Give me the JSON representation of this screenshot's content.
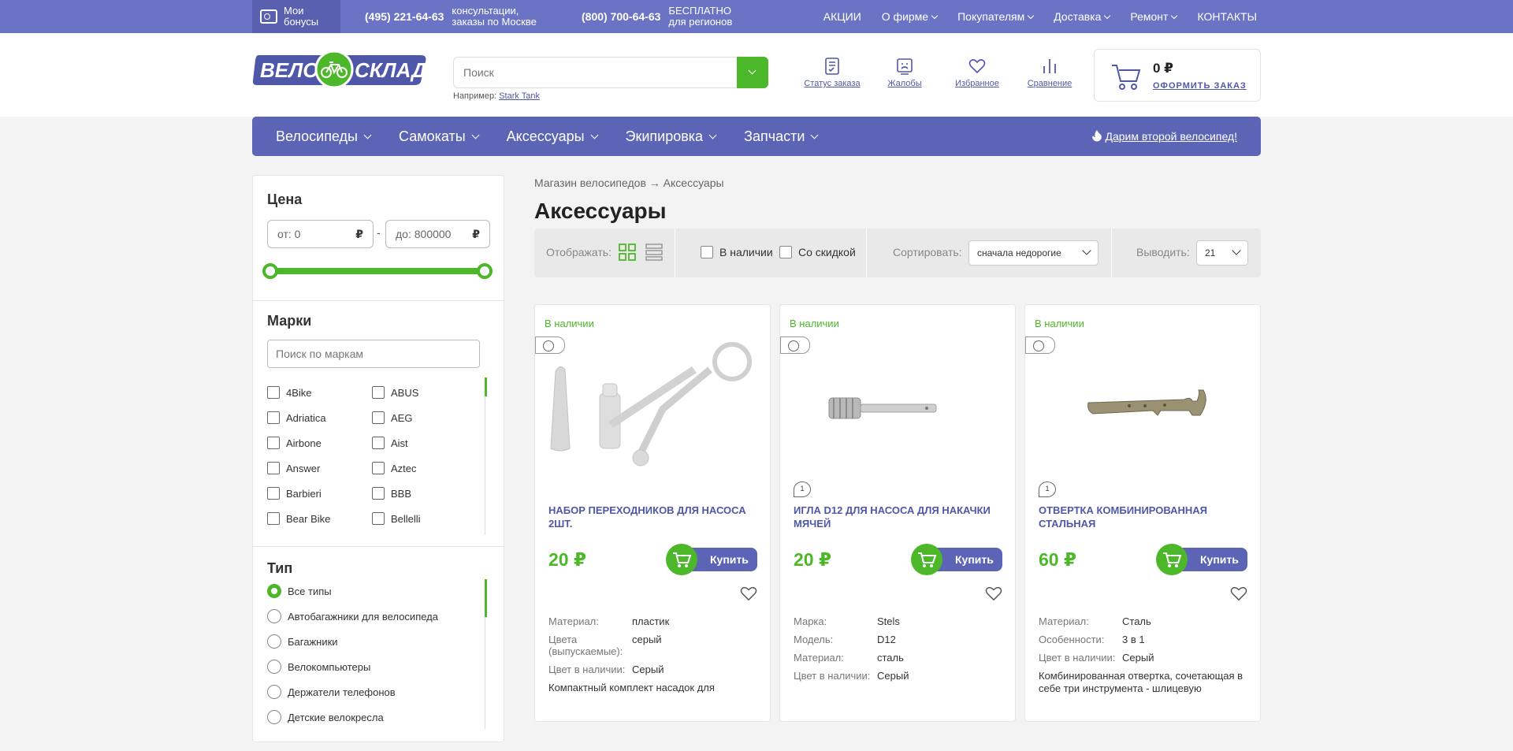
{
  "topbar": {
    "bonus": "Мои бонусы",
    "phone1": "(495) 221-64-63",
    "phone1_note": "консультации, заказы по Москве",
    "phone2": "(800) 700-64-63",
    "phone2_note": "БЕСПЛАТНО для регионов",
    "nav": [
      {
        "label": "АКЦИИ",
        "dropdown": false
      },
      {
        "label": "О фирме",
        "dropdown": true
      },
      {
        "label": "Покупателям",
        "dropdown": true
      },
      {
        "label": "Доставка",
        "dropdown": true
      },
      {
        "label": "Ремонт",
        "dropdown": true
      },
      {
        "label": "КОНТАКТЫ",
        "dropdown": false
      }
    ]
  },
  "header": {
    "logo_left": "ВЕЛО",
    "logo_right": "СКЛАД",
    "search_placeholder": "Поиск",
    "example_label": "Например:",
    "example_value": "Stark Tank",
    "icons": [
      {
        "label": "Статус заказа",
        "icon": "order-status-icon"
      },
      {
        "label": "Жалобы",
        "icon": "complaints-icon"
      },
      {
        "label": "Избранное",
        "icon": "heart-icon"
      },
      {
        "label": "Сравнение",
        "icon": "compare-icon"
      }
    ],
    "cart_sum": "0 ₽",
    "cart_order": "ОФОРМИТЬ ЗАКАЗ"
  },
  "mainnav": {
    "items": [
      "Велосипеды",
      "Самокаты",
      "Аксессуары",
      "Экипировка",
      "Запчасти"
    ],
    "gift": "Дарим второй велосипед!"
  },
  "filters": {
    "price_title": "Цена",
    "price_from_label": "от:",
    "price_from": "0",
    "price_to_label": "до:",
    "price_to": "800000",
    "currency": "₽",
    "dash": "-",
    "brands_title": "Марки",
    "brand_search_placeholder": "Поиск по маркам",
    "brands_left": [
      "4Bike",
      "Adriatica",
      "Airbone",
      "Answer",
      "Barbieri",
      "Bear Bike"
    ],
    "brands_right": [
      "ABUS",
      "AEG",
      "Aist",
      "Aztec",
      "BBB",
      "Bellelli"
    ],
    "type_title": "Тип",
    "types": [
      "Все типы",
      "Автобагажники для велосипеда",
      "Багажники",
      "Велокомпьютеры",
      "Держатели телефонов",
      "Детские велокресла"
    ],
    "type_selected": 0
  },
  "page": {
    "breadcrumb": "Магазин велосипедов → Аксессуары",
    "title": "Аксессуары"
  },
  "toolbar": {
    "display_label": "Отображать:",
    "in_stock": "В наличии",
    "discount": "Со скидкой",
    "sort_label": "Сортировать:",
    "sort_value": "сначала недорогие",
    "show_label": "Выводить:",
    "show_value": "21"
  },
  "products": [
    {
      "stock": "В наличии",
      "name": "НАБОР ПЕРЕХОДНИКОВ ДЛЯ НАСОСА 2ШТ.",
      "price": "20 ₽",
      "buy": "Купить",
      "comments": "",
      "props": [
        [
          "Материал:",
          "пластик"
        ],
        [
          "Цвета (выпускаемые):",
          "серый"
        ],
        [
          "Цвет в наличии:",
          "Серый"
        ]
      ],
      "desc": "Компактный комплект насадок для"
    },
    {
      "stock": "В наличии",
      "name": "ИГЛА D12 ДЛЯ НАСОСА ДЛЯ НАКАЧКИ МЯЧЕЙ",
      "price": "20 ₽",
      "buy": "Купить",
      "comments": "1",
      "props": [
        [
          "Марка:",
          "Stels"
        ],
        [
          "Модель:",
          "D12"
        ],
        [
          "Материал:",
          "сталь"
        ],
        [
          "Цвет в наличии:",
          "Серый"
        ]
      ],
      "desc": ""
    },
    {
      "stock": "В наличии",
      "name": "ОТВЕРТКА КОМБИНИРОВАННАЯ СТАЛЬНАЯ",
      "price": "60 ₽",
      "buy": "Купить",
      "comments": "1",
      "props": [
        [
          "Материал:",
          "Сталь"
        ],
        [
          "Особенности:",
          "3 в 1"
        ],
        [
          "Цвет в наличии:",
          "Серый"
        ]
      ],
      "desc": "Комбинированная отвертка, сочетающая в себе три инструмента - шлицевую"
    }
  ],
  "colors": {
    "brand": "#5c64b5",
    "accent": "#4db72a",
    "topbar": "#6b74c4"
  }
}
